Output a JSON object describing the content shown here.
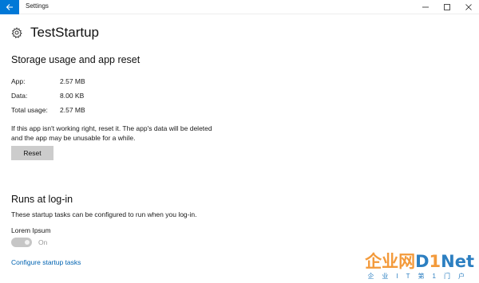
{
  "window": {
    "title": "Settings"
  },
  "header": {
    "title": "TestStartup",
    "icon": "gear-icon"
  },
  "storage": {
    "title": "Storage usage and app reset",
    "rows": [
      {
        "key": "App:",
        "value": "2.57 MB"
      },
      {
        "key": "Data:",
        "value": "8.00 KB"
      },
      {
        "key": "Total usage:",
        "value": "2.57 MB"
      }
    ],
    "reset_text_line1": "If this app isn't working right, reset it. The app's data will be deleted",
    "reset_text_line2": "and the app may be unusable for a while.",
    "reset_label": "Reset"
  },
  "startup": {
    "title": "Runs at log-in",
    "description": "These startup tasks can be configured to run when you log-in.",
    "task_name": "Lorem Ipsum",
    "toggle_state": "On",
    "toggle_enabled": false,
    "configure_link": "Configure startup tasks"
  },
  "watermark": {
    "main_cn": "企业网",
    "main_d": "D",
    "main_one": "1",
    "main_net": "Net",
    "sub": "企业IT第1门户"
  },
  "colors": {
    "accent": "#0078d7",
    "link": "#0063b1",
    "button": "#cccccc"
  }
}
